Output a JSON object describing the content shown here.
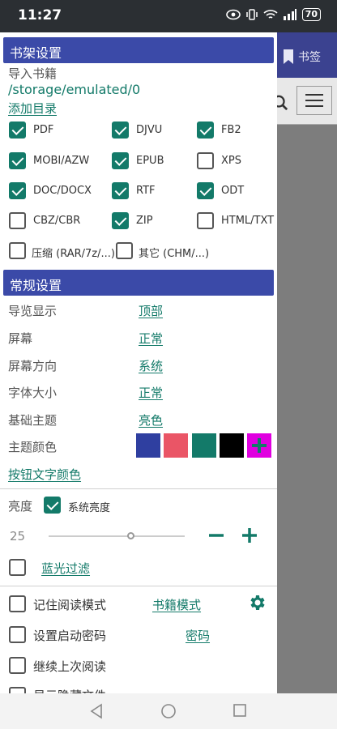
{
  "status": {
    "time": "11:27",
    "battery": "70"
  },
  "bg": {
    "bookmark_label": "书签"
  },
  "shelf": {
    "header": "书架设置",
    "import_label": "导入书籍",
    "path": "/storage/emulated/0",
    "add_dir": "添加目录",
    "formats": [
      {
        "label": "PDF",
        "checked": true
      },
      {
        "label": "DJVU",
        "checked": true
      },
      {
        "label": "FB2",
        "checked": true
      },
      {
        "label": "MOBI/AZW",
        "checked": true
      },
      {
        "label": "EPUB",
        "checked": true
      },
      {
        "label": "XPS",
        "checked": false
      },
      {
        "label": "DOC/DOCX",
        "checked": true
      },
      {
        "label": "RTF",
        "checked": true
      },
      {
        "label": "ODT",
        "checked": true
      },
      {
        "label": "CBZ/CBR",
        "checked": false
      },
      {
        "label": "ZIP",
        "checked": true
      },
      {
        "label": "HTML/TXT",
        "checked": false
      },
      {
        "label": "压缩 (RAR/7z/...)",
        "checked": false
      },
      {
        "label": "其它 (CHM/...)",
        "checked": false
      }
    ]
  },
  "general": {
    "header": "常规设置",
    "rows": [
      {
        "label": "导览显示",
        "value": "顶部"
      },
      {
        "label": "屏幕",
        "value": "正常"
      },
      {
        "label": "屏幕方向",
        "value": "系统"
      },
      {
        "label": "字体大小",
        "value": "正常"
      },
      {
        "label": "基础主题",
        "value": "亮色"
      }
    ],
    "theme_color_label": "主题颜色",
    "swatches": [
      "#2f3fa0",
      "#ea5566",
      "#137a69",
      "#000000",
      "#e000e0"
    ],
    "button_text_color": "按钮文字颜色",
    "brightness_label": "亮度",
    "system_brightness": "系统亮度",
    "brightness_value": "25",
    "brightness_level": 0.6,
    "blue_filter": "蓝光过滤",
    "remember_mode": "记住阅读模式",
    "book_mode": "书籍模式",
    "startup_password": "设置启动密码",
    "password": "密码",
    "continue_reading": "继续上次阅读",
    "show_hidden": "显示隐藏文件"
  },
  "colors": {
    "accent": "#137a69",
    "header": "#3b4aa8"
  }
}
